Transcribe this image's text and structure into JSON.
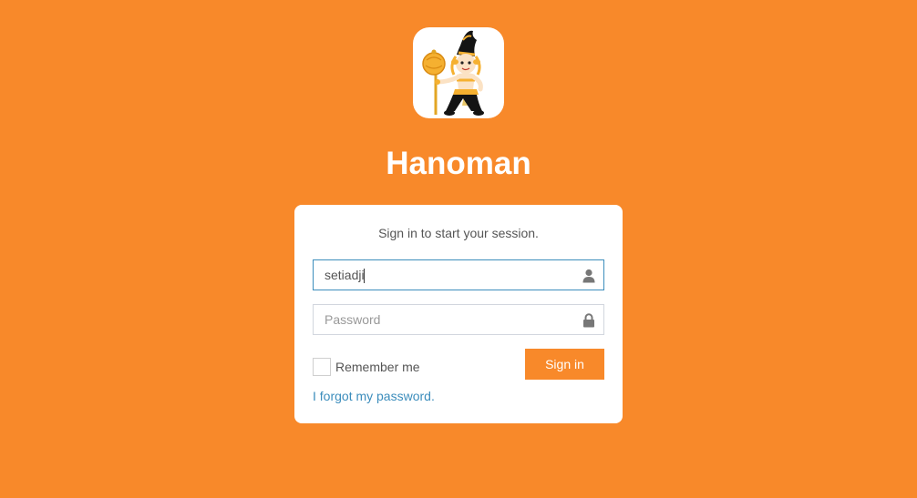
{
  "app": {
    "title": "Hanoman"
  },
  "login": {
    "message": "Sign in to start your session.",
    "username": {
      "value": "setiadji",
      "icon": "user-icon"
    },
    "password": {
      "placeholder": "Password",
      "icon": "lock-icon"
    },
    "remember_label": "Remember me",
    "remember_checked": false,
    "signin_label": "Sign in",
    "forgot_label": "I forgot my password."
  },
  "colors": {
    "background": "#f8892a",
    "button": "#f8892a",
    "link": "#3c8dbc",
    "focus_border": "#3c8dbc"
  },
  "logo": {
    "icon": "hanoman-mascot-logo"
  }
}
